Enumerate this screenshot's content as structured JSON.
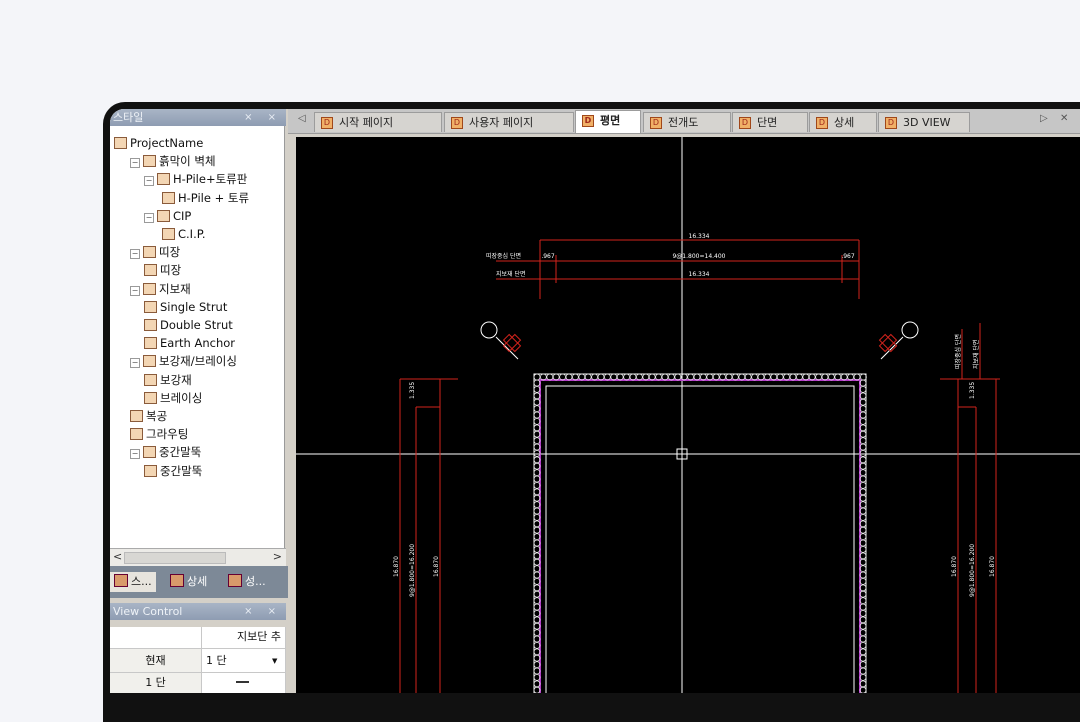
{
  "left_panel": {
    "title": "스타일",
    "title_buttons": "⨯ ×",
    "tree": [
      {
        "label": "ProjectName",
        "level": 0,
        "icon": "project-icon"
      },
      {
        "label": "흙막이 벽체",
        "level": 1,
        "icon": "wall-icon"
      },
      {
        "label": "H-Pile+토류판",
        "level": 2,
        "icon": "hpile-icon"
      },
      {
        "label": "H-Pile + 토류",
        "level": 3,
        "icon": "hpile-item-icon"
      },
      {
        "label": "CIP",
        "level": 2,
        "icon": "cip-icon"
      },
      {
        "label": "C.I.P.",
        "level": 3,
        "icon": "cip-item-icon"
      },
      {
        "label": "띠장",
        "level": 1,
        "icon": "waler-icon"
      },
      {
        "label": "띠장",
        "level": 2,
        "icon": "waler-item-icon"
      },
      {
        "label": "지보재",
        "level": 1,
        "icon": "support-icon"
      },
      {
        "label": "Single Strut",
        "level": 2,
        "icon": "strut-icon"
      },
      {
        "label": "Double Strut",
        "level": 2,
        "icon": "strut-icon"
      },
      {
        "label": "Earth Anchor",
        "level": 2,
        "icon": "anchor-icon"
      },
      {
        "label": "보강재/브레이싱",
        "level": 1,
        "icon": "brace-icon"
      },
      {
        "label": "보강재",
        "level": 2,
        "icon": "stiffener-icon"
      },
      {
        "label": "브레이싱",
        "level": 2,
        "icon": "bracing-icon"
      },
      {
        "label": "복공",
        "level": 1,
        "icon": "deck-icon"
      },
      {
        "label": "그라우팅",
        "level": 1,
        "icon": "grout-icon"
      },
      {
        "label": "중간말뚝",
        "level": 1,
        "icon": "pile-icon"
      },
      {
        "label": "중간말뚝",
        "level": 2,
        "icon": "pile-item-icon"
      }
    ],
    "bottom_tabs": [
      "스...",
      "상세",
      "성..."
    ],
    "view_control": {
      "title": "View Control",
      "header": "지보단 추",
      "rows": [
        {
          "label": "현재",
          "value": "1 단"
        },
        {
          "label": "1 단",
          "value": ""
        }
      ]
    }
  },
  "tabs": [
    {
      "label": "시작 페이지",
      "active": false
    },
    {
      "label": "사용자 페이지",
      "active": false
    },
    {
      "label": "평면",
      "active": true
    },
    {
      "label": "전개도",
      "active": false
    },
    {
      "label": "단면",
      "active": false
    },
    {
      "label": "상세",
      "active": false
    },
    {
      "label": "3D VIEW",
      "active": false
    }
  ],
  "drawing": {
    "dim_top": "16.334",
    "dim_mid": "9@1.800=14.400",
    "dim_mid_left": ".967",
    "dim_mid_right": ".967",
    "dim_bot": "16.334",
    "label_top_left": "띠장중심 단면",
    "label_bot_left": "지보재 단면",
    "dim_left_vertical": "16.870",
    "dim_left_vertical_mid": "9@1.800=16.200",
    "dim_right_vertical": "16.870",
    "dim_right_vertical_mid": "9@1.800=16.200",
    "small_dim_left": "1.335",
    "small_dim_right": "1.335",
    "colors": {
      "dim": "#d2231c",
      "wall": "#ffffff",
      "waler": "#b43cc8",
      "crosshair": "#ffffff"
    }
  }
}
